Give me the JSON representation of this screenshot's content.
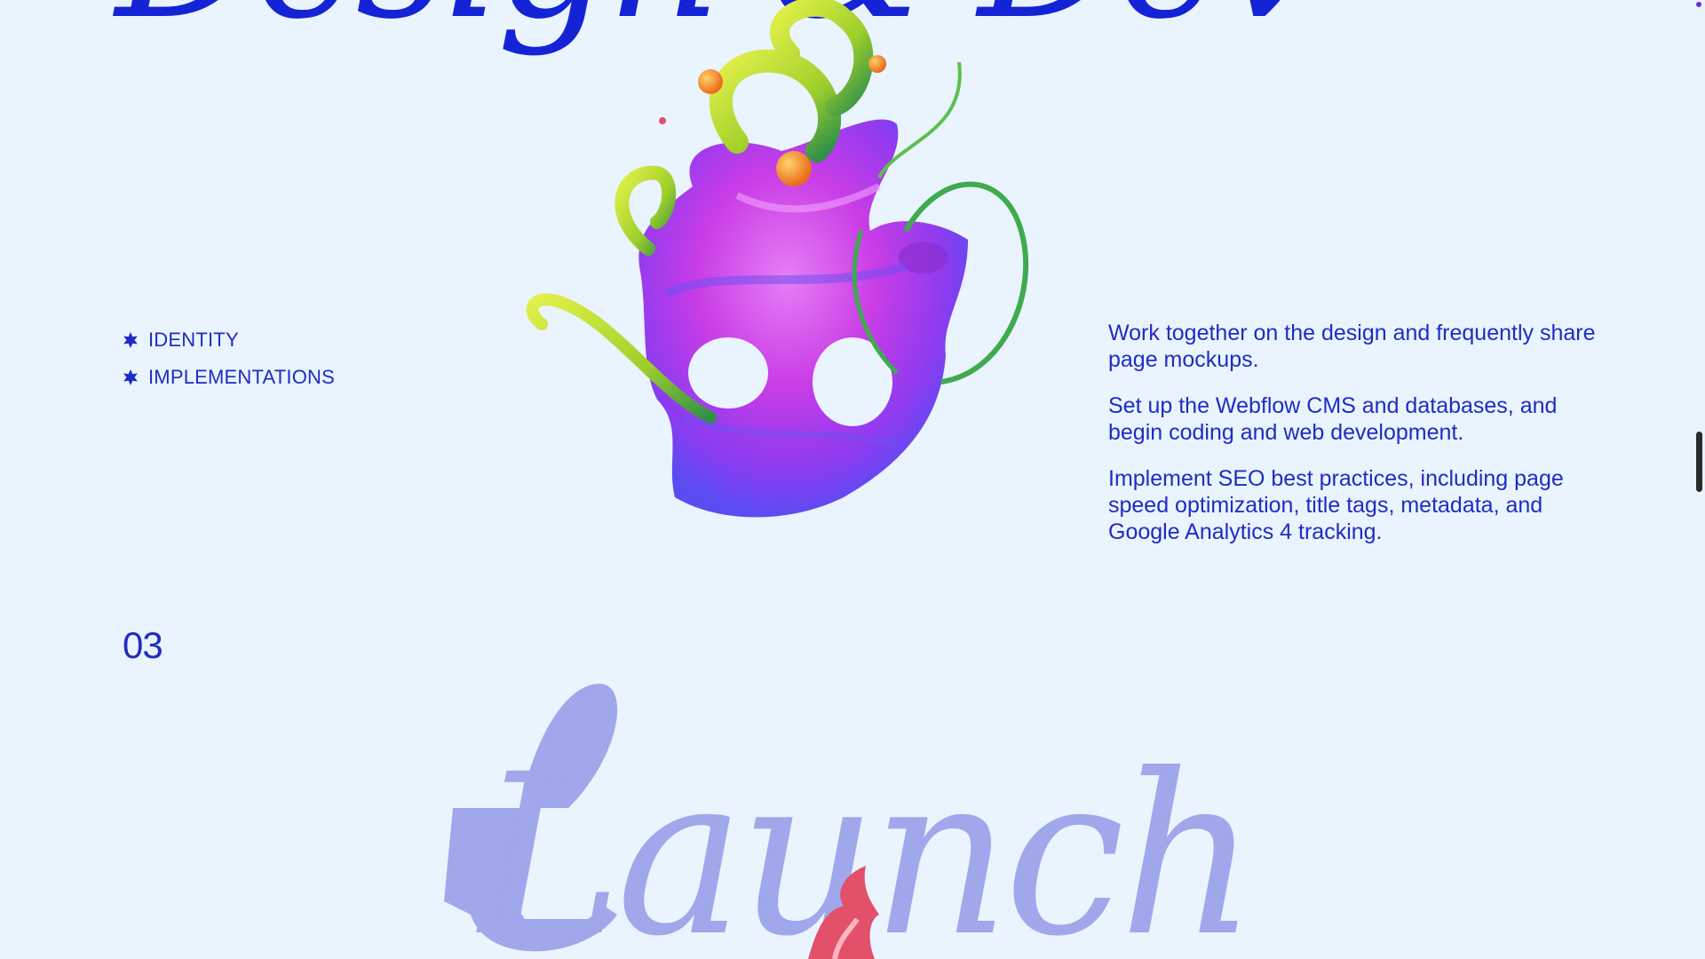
{
  "hero": {
    "title": "Design & Dev"
  },
  "services": [
    {
      "label": "IDENTITY",
      "icon": "star-bullet-icon"
    },
    {
      "label": "IMPLEMENTATIONS",
      "icon": "star-bullet-icon"
    }
  ],
  "description": [
    "Work together on the design and frequently share page mockups.",
    "Set up the Webflow CMS and databases, and begin coding and web development.",
    "Implement SEO best practices, including page speed optimization, title tags, metadata, and Google Analytics 4 tracking."
  ],
  "next_section": {
    "number": "03",
    "title": "Launch"
  },
  "colors": {
    "background": "#e9f4fe",
    "text": "#1f2cc3",
    "heading_blue": "#1423d6",
    "launch_lavender": "#a0a7eb",
    "sculpture_purple": "#c94ee8",
    "sculpture_green": "#b7d92b",
    "sculpture_red": "#e2506a"
  }
}
